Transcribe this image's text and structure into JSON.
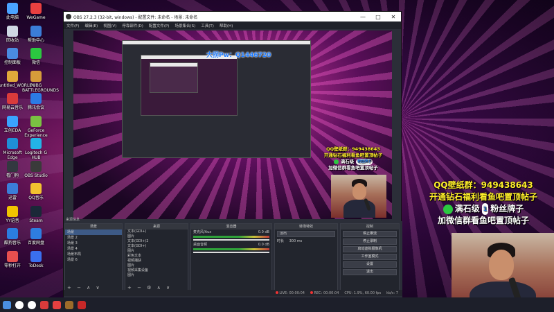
{
  "desktop_icons": [
    {
      "label": "此电脑",
      "color": "#4aa3ff"
    },
    {
      "label": "WeGame",
      "color": "#e94040"
    },
    {
      "label": "回收站",
      "color": "#cfd8e3"
    },
    {
      "label": "帮助中心",
      "color": "#3b7dd8"
    },
    {
      "label": "控制面板",
      "color": "#4a8be0"
    },
    {
      "label": "微信",
      "color": "#2bc840"
    },
    {
      "label": "untitled_WORLD4",
      "color": "#e0a83a"
    },
    {
      "label": "PUBG BATTLEGROUNDS",
      "color": "#d69c3a"
    },
    {
      "label": "网易云音乐",
      "color": "#d93b3b"
    },
    {
      "label": "腾讯会议",
      "color": "#2c7be5"
    },
    {
      "label": "立创EDA",
      "color": "#3aa3ff"
    },
    {
      "label": "GeForce Experience",
      "color": "#7ac142"
    },
    {
      "label": "Microsoft Edge",
      "color": "#1f8fd6"
    },
    {
      "label": "Logitech G HUB",
      "color": "#23b4e6"
    },
    {
      "label": "看门狗",
      "color": "#333840"
    },
    {
      "label": "OBS Studio",
      "color": "#3a3a3a"
    },
    {
      "label": "迅雷",
      "color": "#3b7dd8"
    },
    {
      "label": "QQ音乐",
      "color": "#f2c230"
    },
    {
      "label": "YY语音",
      "color": "#f0c400"
    },
    {
      "label": "Steam",
      "color": "#1b2838"
    },
    {
      "label": "酷狗音乐",
      "color": "#2b7de0"
    },
    {
      "label": "百度网盘",
      "color": "#2e7de0"
    },
    {
      "label": "零秒打开",
      "color": "#e64f4f"
    },
    {
      "label": "ToDesk",
      "color": "#3a6ff0"
    }
  ],
  "obs_window": {
    "title": "OBS 27.2.3 (32-bit, windows) - 配置文件: 未命名 - 场景: 未命名",
    "menu": [
      "文件(F)",
      "编辑(E)",
      "视图(V)",
      "停靠部件(D)",
      "配置文件(P)",
      "场景集合(S)",
      "工具(T)",
      "帮助(H)"
    ],
    "controls": {
      "minimize": "—",
      "maximize": "□",
      "close": "✕"
    }
  },
  "overlay": {
    "pw_text": "大拐Pw：Q1446720",
    "qq_group": "QQ壁纸群：949438643",
    "diamond_line": "开通钻石福利看鱼吧置顶帖子",
    "fan_badge_prefix": "满石级",
    "fan_badge_chip": "粉丝牌子",
    "fan_badge_chip_small": "1",
    "wechat_line": "加微信群看鱼吧置顶帖子"
  },
  "docks": {
    "source_title": "来源信息",
    "scenes_header": "场景",
    "sources_header": "来源",
    "mixer_header": "混音器",
    "transitions_header": "转场特效",
    "controls_header": "控制",
    "scenes": [
      "场景",
      "场景 2",
      "场景 3",
      "场景 4",
      "场景布局",
      "场景 6"
    ],
    "sources": [
      "文本(GDI+)",
      "图片",
      "文本(GDI+)2",
      "文本(GDI+)",
      "图片",
      "彩色文本",
      "视频捕获",
      "图片",
      "视频采集设备",
      "图片"
    ],
    "mixer": [
      {
        "name": "麦克风/Aux",
        "db": "0.0 dB"
      },
      {
        "name": "桌面音频",
        "db": "0.0 dB"
      }
    ],
    "transition": {
      "type": "淡出",
      "duration_label": "时长",
      "duration": "300 ms"
    },
    "controls": [
      "停止推流",
      "停止录制",
      "启动虚拟摄像机",
      "工作室模式",
      "设置",
      "退出"
    ]
  },
  "status_bar": {
    "live": "LIVE: 00:00:04",
    "rec": "REC: 00:00:04",
    "cpu": "CPU: 1.9%, 60.00 fps",
    "kbps": "kb/s: 7"
  },
  "taskbar_apps": [
    {
      "name": "start",
      "color": "#4a90e2"
    },
    {
      "name": "search",
      "color": "#ffffff"
    },
    {
      "name": "browser",
      "color": "#ffffff"
    },
    {
      "name": "netease",
      "color": "#d93b3b"
    },
    {
      "name": "wegame",
      "color": "#e64040"
    },
    {
      "name": "ghub",
      "color": "#9c6b2a"
    },
    {
      "name": "obs",
      "color": "#c62828"
    }
  ]
}
